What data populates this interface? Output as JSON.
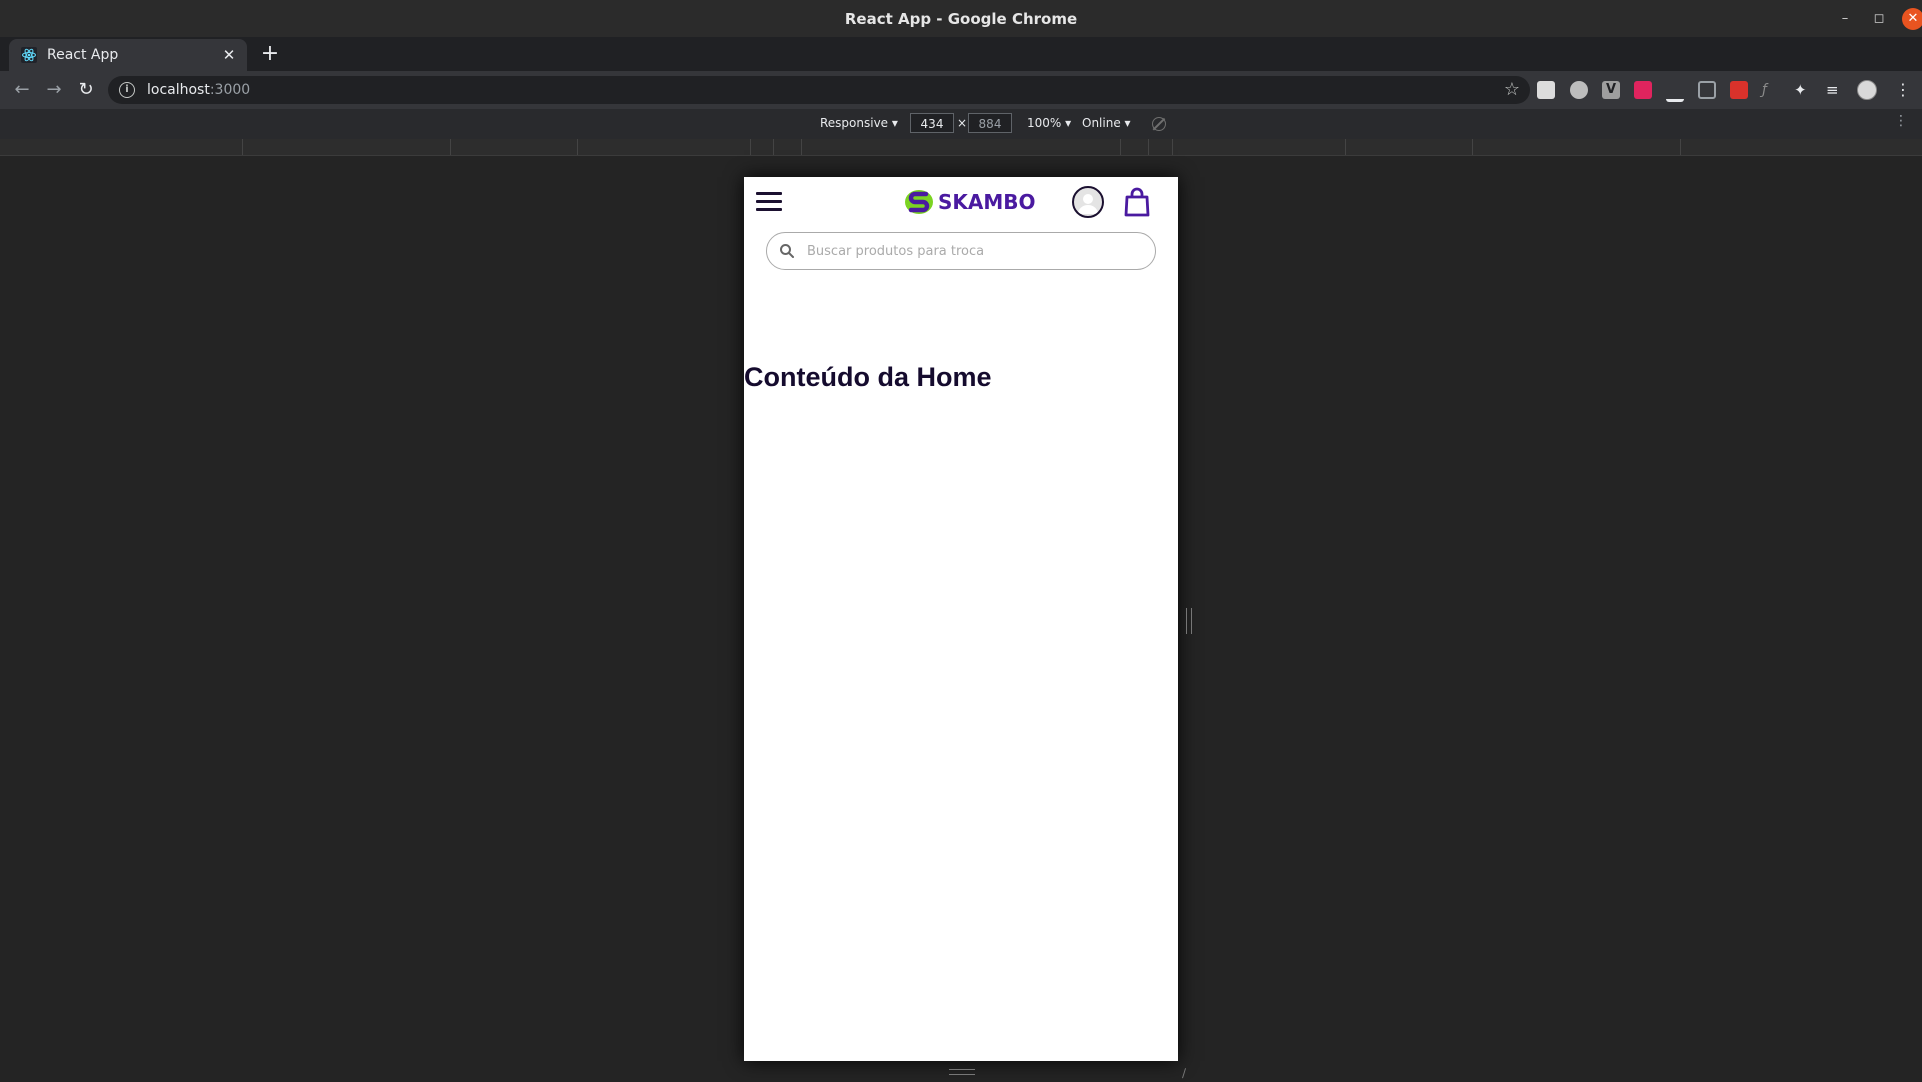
{
  "window": {
    "title": "React App - Google Chrome",
    "controls": [
      "minimize",
      "maximize",
      "close"
    ]
  },
  "tabs": [
    {
      "label": "React App",
      "favicon": "react-icon",
      "active": true
    }
  ],
  "toolbar": {
    "url_host": "localhost",
    "url_port": ":3000",
    "extensions": [
      "extension-icon-1",
      "extension-icon-2",
      "vimium-icon",
      "vscode-icon",
      "pen-icon",
      "window-icon",
      "gift-icon",
      "fx-icon",
      "puzzle-icon",
      "playlist-icon"
    ]
  },
  "devtools": {
    "device": "Responsive",
    "width": "434",
    "height": "884",
    "times": "×",
    "zoom": "100%",
    "network": "Online"
  },
  "app": {
    "logo_text": "SKAMBO",
    "search_placeholder": "Buscar produtos para troca",
    "home_title": "Conteúdo da Home",
    "colors": {
      "brand_purple": "#4a1aa0",
      "brand_green": "#7bd322",
      "text_dark": "#150b2e"
    }
  }
}
